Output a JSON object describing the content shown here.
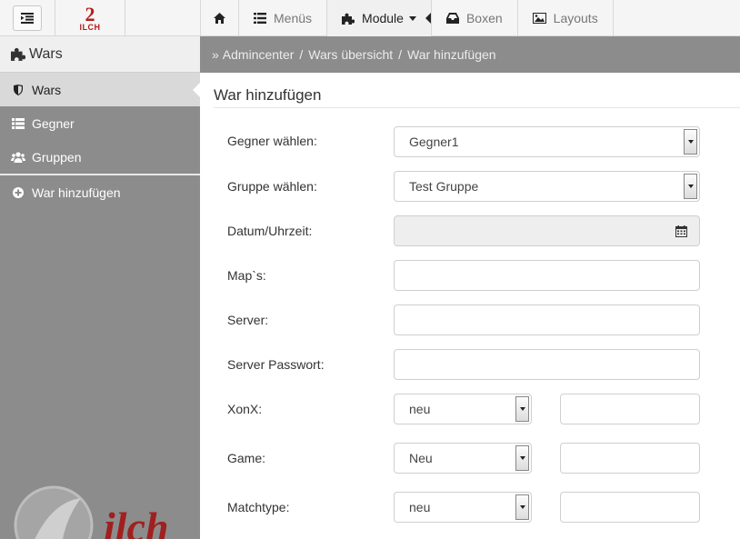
{
  "topbar": {
    "logo_number": "2",
    "logo_text": "ILCH",
    "nav": [
      {
        "label": "",
        "icon": "home-icon"
      },
      {
        "label": "Menüs",
        "icon": "list-icon"
      },
      {
        "label": "Module",
        "icon": "puzzle-icon"
      },
      {
        "label": "Boxen",
        "icon": "inbox-icon"
      },
      {
        "label": "Layouts",
        "icon": "picture-icon"
      }
    ]
  },
  "sidebar": {
    "header": "Wars",
    "items": [
      {
        "label": "Wars",
        "icon": "shield-icon"
      },
      {
        "label": "Gegner",
        "icon": "list-icon"
      },
      {
        "label": "Gruppen",
        "icon": "users-icon"
      },
      {
        "label": "War hinzufügen",
        "icon": "plus-circle-icon"
      }
    ],
    "watermark_text": "ilch"
  },
  "breadcrumb": {
    "prefix": "»",
    "items": [
      "Admincenter",
      "Wars übersicht",
      "War hinzufügen"
    ]
  },
  "form": {
    "title": "War hinzufügen",
    "enemy_label": "Gegner wählen:",
    "enemy_value": "Gegner1",
    "group_label": "Gruppe wählen:",
    "group_value": "Test Gruppe",
    "datetime_label": "Datum/Uhrzeit:",
    "datetime_value": "",
    "maps_label": "Map`s:",
    "maps_value": "",
    "server_label": "Server:",
    "server_value": "",
    "server_pw_label": "Server Passwort:",
    "server_pw_value": "",
    "xonx_label": "XonX:",
    "xonx_select": "neu",
    "xonx_value": "",
    "game_label": "Game:",
    "game_select": "Neu",
    "game_value": "",
    "matchtype_label": "Matchtype:",
    "matchtype_select": "neu",
    "matchtype_value": ""
  },
  "colors": {
    "sidebar_bg": "#8c8c8c",
    "brand_red": "#b21e1e",
    "active_item_bg": "#d9d9d9"
  }
}
